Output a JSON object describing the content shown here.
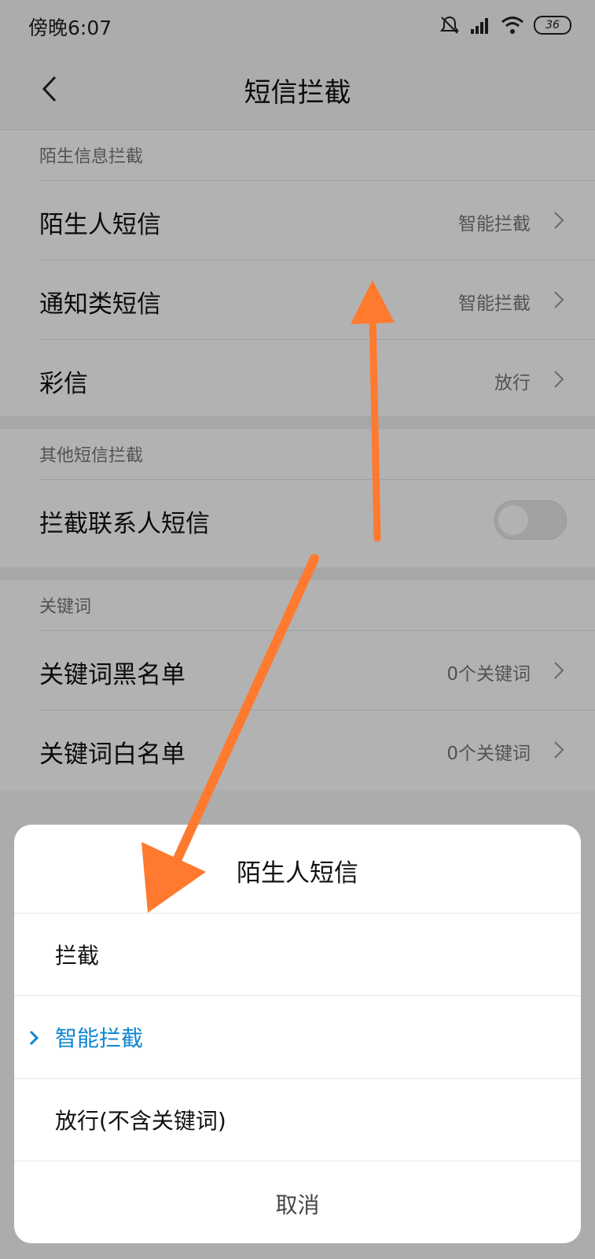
{
  "status_bar": {
    "time": "傍晚6:07",
    "battery": "36",
    "icons": [
      "mute-icon",
      "signal-icon",
      "wifi-icon",
      "battery-icon"
    ]
  },
  "header": {
    "title": "短信拦截",
    "back_icon": "back-arrow-icon"
  },
  "sections": [
    {
      "header": "陌生信息拦截",
      "rows": [
        {
          "label": "陌生人短信",
          "value": "智能拦截"
        },
        {
          "label": "通知类短信",
          "value": "智能拦截"
        },
        {
          "label": "彩信",
          "value": "放行"
        }
      ]
    },
    {
      "header": "其他短信拦截",
      "rows": [
        {
          "label": "拦截联系人短信",
          "toggle": false
        }
      ]
    },
    {
      "header": "关键词",
      "rows": [
        {
          "label": "关键词黑名单",
          "value": "0个关键词"
        },
        {
          "label": "关键词白名单",
          "value": "0个关键词"
        }
      ]
    }
  ],
  "dialog": {
    "title": "陌生人短信",
    "options": [
      {
        "label": "拦截",
        "selected": false
      },
      {
        "label": "智能拦截",
        "selected": true
      },
      {
        "label": "放行(不含关键词)",
        "selected": false
      }
    ],
    "cancel_label": "取消"
  },
  "colors": {
    "accent": "#0e86d2",
    "annotation_arrow": "#ff7a2f"
  }
}
